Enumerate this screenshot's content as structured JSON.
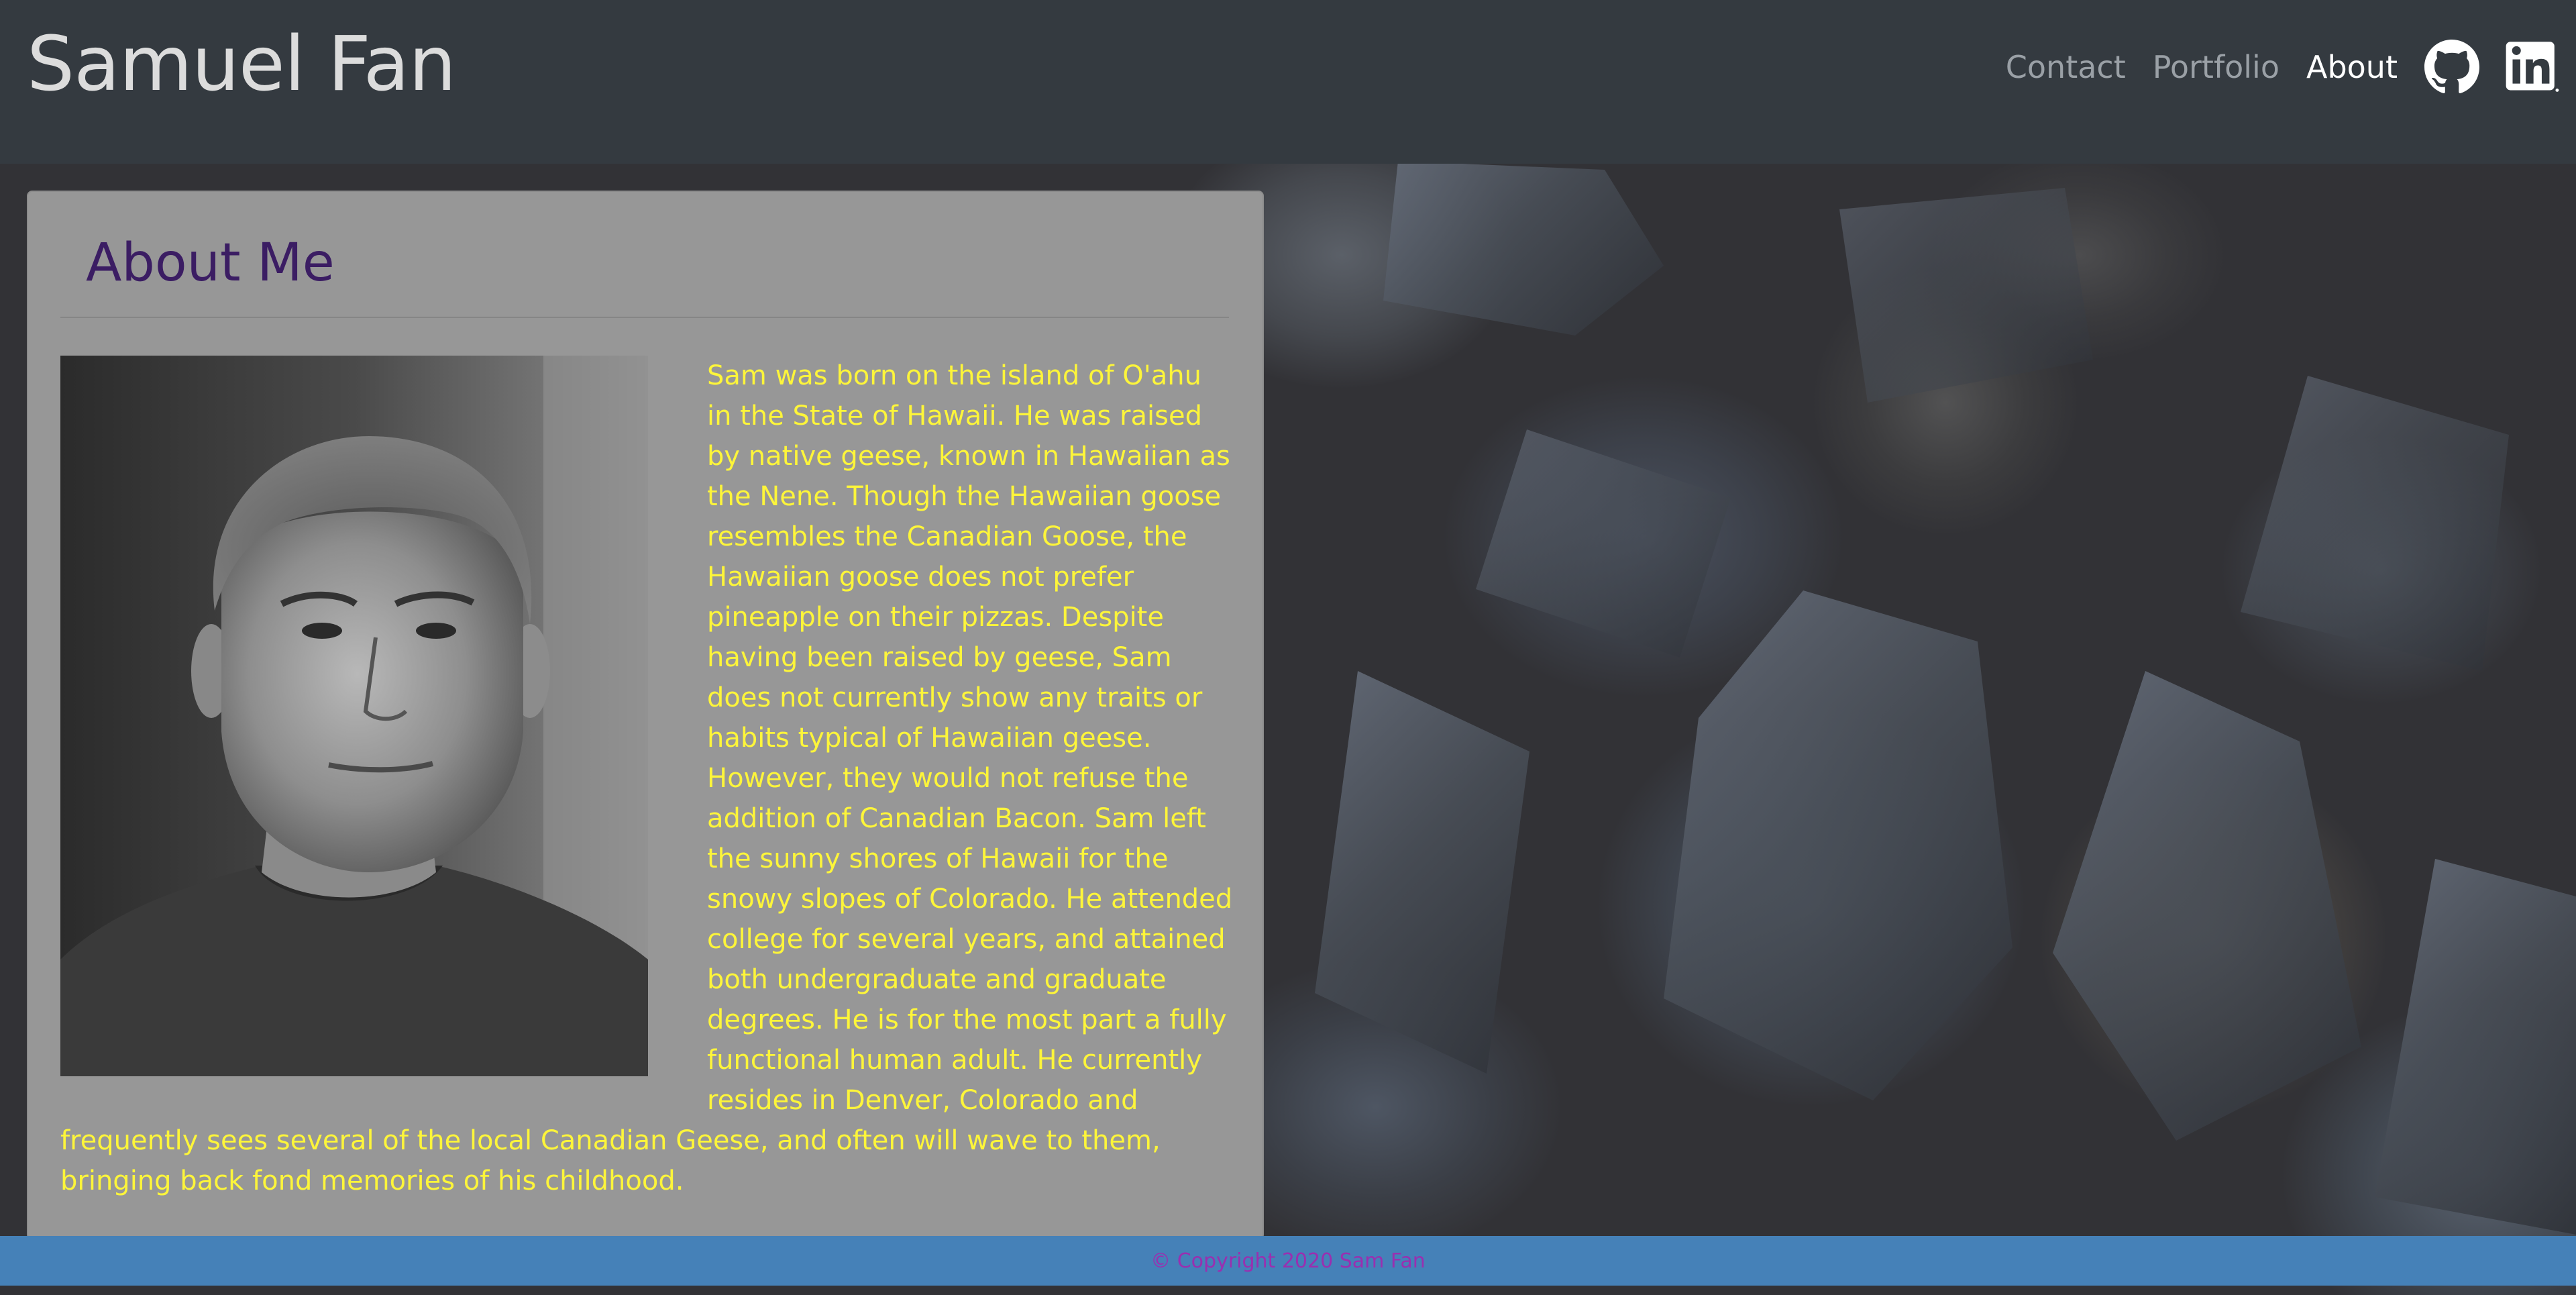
{
  "header": {
    "brand": "Samuel Fan",
    "nav": [
      {
        "label": "Contact",
        "active": false
      },
      {
        "label": "Portfolio",
        "active": false
      },
      {
        "label": "About",
        "active": true
      }
    ],
    "icons": [
      "github-icon",
      "linkedin-icon"
    ]
  },
  "card": {
    "title": "About Me",
    "photo_alt": "Portrait of Samuel Fan",
    "bio": "Sam was born on the island of O'ahu in the State of Hawaii. He was raised by native geese, known in Hawaiian as the Nene. Though the Hawaiian goose resembles the Canadian Goose, the Hawaiian goose does not prefer pineapple on their pizzas. Despite having been raised by geese, Sam does not currently show any traits or habits typical of Hawaiian geese. However, they would not refuse the addition of Canadian Bacon. Sam left the sunny shores of Hawaii for the snowy slopes of Colorado. He attended college for several years, and attained both undergraduate and graduate degrees. He is for the most part a fully functional human adult. He currently resides in Denver, Colorado and frequently sees several of the local Canadian Geese, and often will wave to them, bringing back fond memories of his childhood."
  },
  "footer": {
    "copyright": "© Copyright 2020 Sam Fan"
  },
  "colors": {
    "header_bg": "#343a40",
    "card_bg": "#979797",
    "title": "#3b1d63",
    "bio_text": "#fdf53a",
    "footer_bg": "#4581b8",
    "footer_text": "#9a2fb0"
  }
}
